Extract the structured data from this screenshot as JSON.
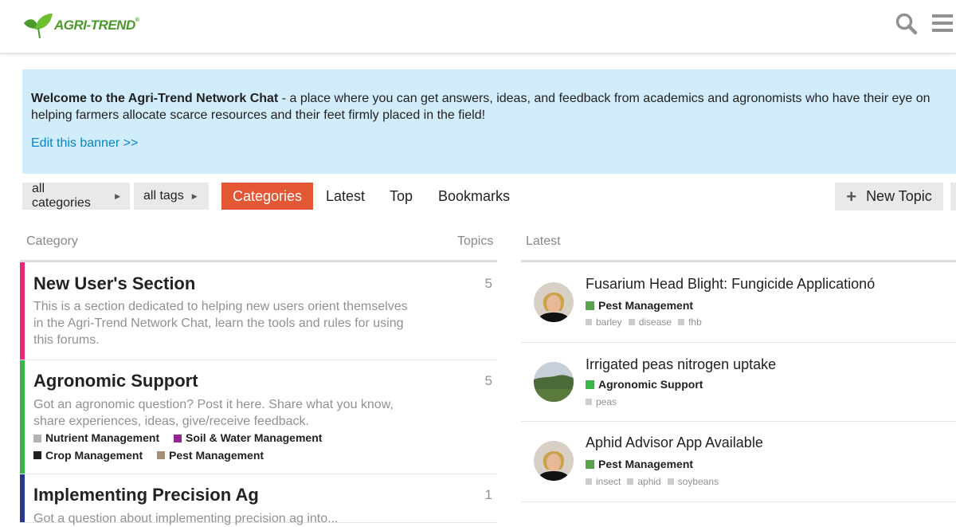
{
  "header": {
    "logo_text": "AGRI-TREND",
    "logo_reg": "®",
    "search_icon": "search-icon",
    "menu_icon": "hamburger-menu-icon"
  },
  "banner": {
    "bold": "Welcome to the Agri-Trend Network Chat",
    "text": " - a place where you can get answers, ideas, and feedback from academics and agronomists who have their eye on helping farmers allocate scarce resources and their feet firmly placed in the field!",
    "edit_link": "Edit this banner >>"
  },
  "nav": {
    "all_categories": "all categories",
    "all_tags": "all tags",
    "tabs": [
      "Categories",
      "Latest",
      "Top",
      "Bookmarks"
    ],
    "active_tab": "Categories",
    "new_topic": "New Topic"
  },
  "columns": {
    "category": "Category",
    "topics": "Topics",
    "latest": "Latest"
  },
  "categories": [
    {
      "title": "New User's Section",
      "count": "5",
      "color": "#e62a78",
      "description": "This is a section dedicated to helping new users orient themselves in the Agri-Trend Network Chat, learn the tools and rules for using this forums."
    },
    {
      "title": "Agronomic Support",
      "count": "5",
      "color": "#3ab54a",
      "description": "Got an agronomic question? Post it here. Share what you know, share experiences, ideas, give/receive feedback.",
      "subcategories": [
        {
          "name": "Nutrient Management",
          "color": "#b3b3b3"
        },
        {
          "name": "Soil & Water Management",
          "color": "#92278f"
        },
        {
          "name": "Crop Management",
          "color": "#231f20"
        },
        {
          "name": "Pest Management",
          "color": "#a59075"
        }
      ]
    },
    {
      "title": "Implementing Precision Ag",
      "count": "1",
      "color": "#283890",
      "description": "Got a question about implementing precision ag into..."
    }
  ],
  "topics": [
    {
      "title": "Fusarium Head Blight: Fungicide Applicationó",
      "category": "Pest Management",
      "category_color": "#58a24a",
      "tags": [
        "barley",
        "disease",
        "fhb"
      ]
    },
    {
      "title": "Irrigated peas nitrogen uptake",
      "category": "Agronomic Support",
      "category_color": "#3ab54a",
      "tags": [
        "peas"
      ]
    },
    {
      "title": "Aphid Advisor App Available",
      "category": "Pest Management",
      "category_color": "#58a24a",
      "tags": [
        "insect",
        "aphid",
        "soybeans"
      ]
    }
  ]
}
